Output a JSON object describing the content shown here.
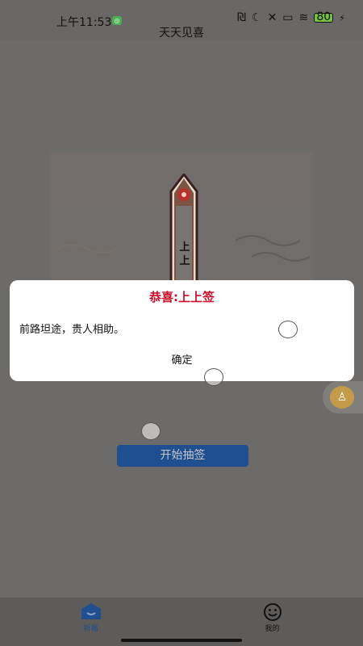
{
  "status_bar": {
    "time": "上午11:53",
    "battery": "80",
    "badge": "◎"
  },
  "app": {
    "title": "天天见喜"
  },
  "lot": {
    "stick_text": "上上"
  },
  "dialog": {
    "title": "恭喜:上上签",
    "message": "前路坦途，贵人相助。",
    "confirm_label": "确定"
  },
  "main": {
    "start_button_label": "开始抽签"
  },
  "tabbar": {
    "tabs": [
      {
        "label": "祈福",
        "icon": "temple-icon",
        "active": true
      },
      {
        "label": "我的",
        "icon": "smiley-icon",
        "active": false
      }
    ]
  },
  "colors": {
    "dialog_title": "#c8102e",
    "start_button": "#1f4f8f",
    "active_tab": "#1f4f8f",
    "float_button": "#c49a4b"
  }
}
